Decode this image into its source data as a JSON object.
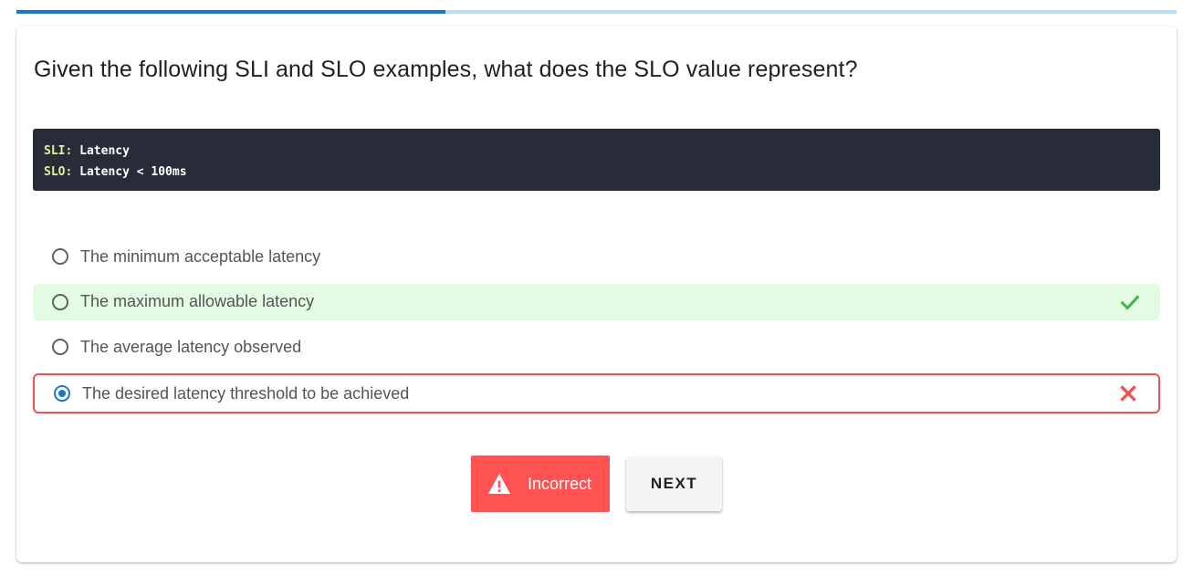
{
  "progress": {
    "fraction": 0.37
  },
  "question": {
    "text": "Given the following SLI and SLO examples, what does the SLO value represent?"
  },
  "code": {
    "lines": [
      {
        "key": "SLI:",
        "value": " Latency"
      },
      {
        "key": "SLO:",
        "value": " Latency < 100ms"
      }
    ]
  },
  "options": [
    {
      "label": "The minimum acceptable latency",
      "selected": false,
      "state": "none"
    },
    {
      "label": "The maximum allowable latency",
      "selected": false,
      "state": "correct"
    },
    {
      "label": "The average latency observed",
      "selected": false,
      "state": "none"
    },
    {
      "label": "The desired latency threshold to be achieved",
      "selected": true,
      "state": "incorrect"
    }
  ],
  "actions": {
    "result_label": "Incorrect",
    "next_label": "NEXT"
  },
  "icons": {
    "correct": "check-icon",
    "incorrect": "cross-icon",
    "warning": "warning-triangle-icon"
  },
  "colors": {
    "accent": "#1976d2",
    "correct_bg": "#e3fbe2",
    "correct_mark": "#4caf50",
    "incorrect": "#ef5350",
    "incorrect_button": "#ff5252"
  }
}
